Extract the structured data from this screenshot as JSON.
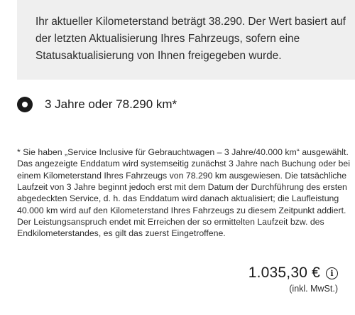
{
  "info_box": {
    "text": "Ihr aktueller Kilometerstand beträgt 38.290. Der Wert basiert auf der letzten Aktualisierung Ihres Fahrzeugs, sofern eine Statusaktualisierung von Ihnen freigegeben wurde."
  },
  "option": {
    "label": "3 Jahre oder 78.290 km*",
    "selected": true
  },
  "footnote": {
    "text": "* Sie haben „Service Inclusive für Gebrauchtwagen – 3 Jahre/40.000 km“ ausgewählt. Das angezeigte Enddatum wird systemseitig zunächst 3 Jahre nach Buchung oder bei einem Kilometerstand Ihres Fahrzeugs von 78.290 km ausgewiesen. Die tatsächliche Laufzeit von 3 Jahre beginnt jedoch erst mit dem Datum der Durchführung des ersten abgedeckten Service, d. h. das Enddatum wird danach aktualisiert; die Laufleistung 40.000 km wird auf den Kilometerstand Ihres Fahrzeugs zu diesem Zeitpunkt addiert. Der Leistungsanspruch endet mit Erreichen der so ermittelten Laufzeit bzw. des Endkilometerstandes, es gilt das zuerst Eingetroffene."
  },
  "price": {
    "amount": "1.035,30 €",
    "vat_note": "(inkl. MwSt.)",
    "info_icon": "info-icon"
  },
  "colors": {
    "info_box_bg": "#efefef",
    "text": "#1a1a1a"
  }
}
